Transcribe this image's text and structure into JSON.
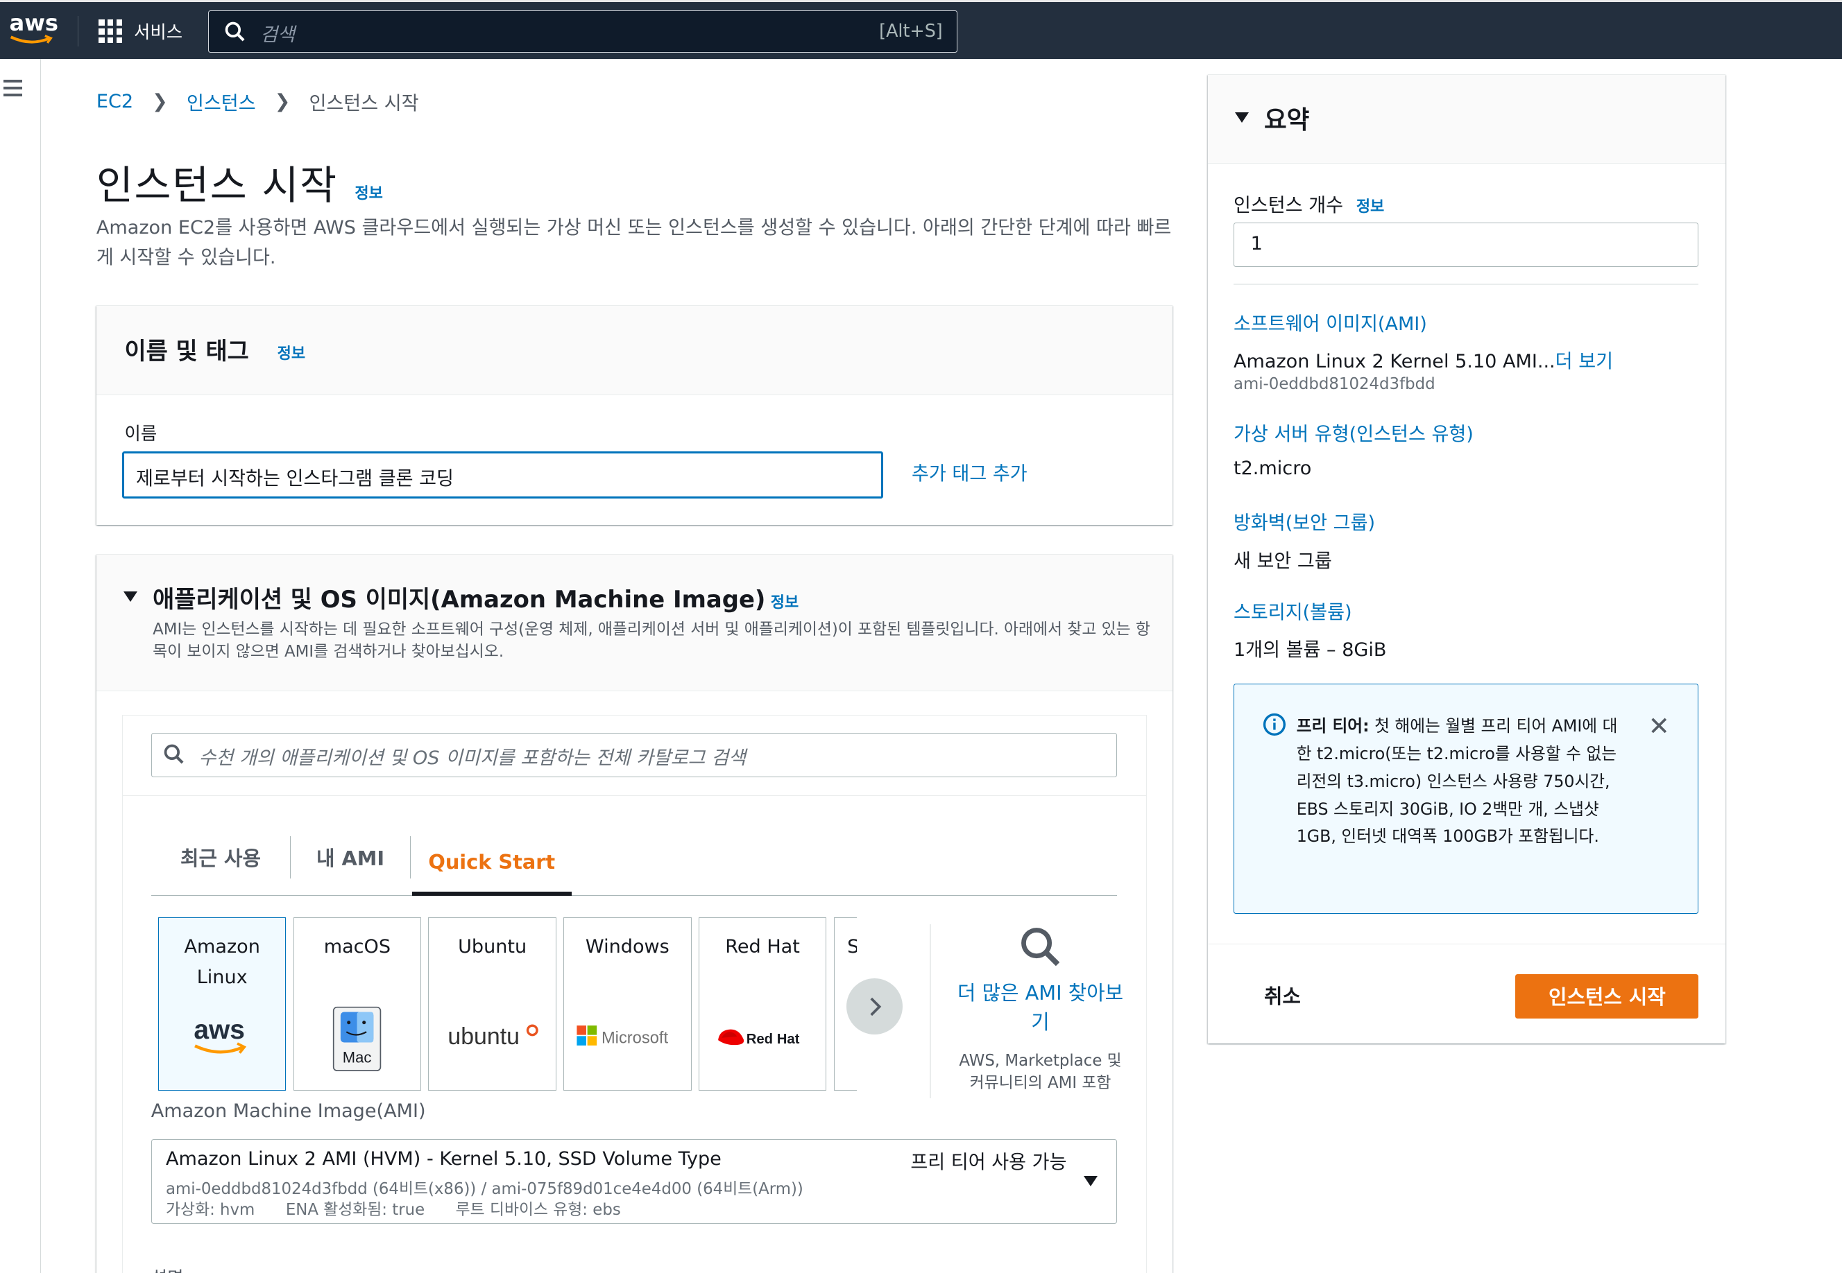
{
  "topnav": {
    "logo_text": "aws",
    "services_label": "서비스",
    "search_placeholder": "검색",
    "search_shortcut": "[Alt+S]"
  },
  "breadcrumb": {
    "items": [
      "EC2",
      "인스턴스",
      "인스턴스 시작"
    ]
  },
  "page": {
    "title": "인스턴스 시작",
    "info": "정보",
    "description": "Amazon EC2를 사용하면 AWS 클라우드에서 실행되는 가상 머신 또는 인스턴스를 생성할 수 있습니다. 아래의 간단한 단계에 따라 빠르게 시작할 수 있습니다."
  },
  "name_tags": {
    "title": "이름 및 태그",
    "info": "정보",
    "name_label": "이름",
    "name_value": "제로부터 시작하는 인스타그램 클론 코딩",
    "add_tag": "추가 태그 추가"
  },
  "ami": {
    "title": "애플리케이션 및 OS 이미지(Amazon Machine Image)",
    "info": "정보",
    "description": "AMI는 인스턴스를 시작하는 데 필요한 소프트웨어 구성(운영 체제, 애플리케이션 서버 및 애플리케이션)이 포함된 템플릿입니다. 아래에서 찾고 있는 항목이 보이지 않으면 AMI를 검색하거나 찾아보십시오.",
    "search_placeholder": "수천 개의 애플리케이션 및 OS 이미지를 포함하는 전체 카탈로그 검색",
    "tabs": [
      "최근 사용",
      "내 AMI",
      "Quick Start"
    ],
    "active_tab": "Quick Start",
    "cards": [
      {
        "label": "Amazon Linux",
        "logo": "aws"
      },
      {
        "label": "macOS",
        "logo": "Mac"
      },
      {
        "label": "Ubuntu",
        "logo": "ubuntu"
      },
      {
        "label": "Windows",
        "logo": "Microsoft"
      },
      {
        "label": "Red Hat",
        "logo": "Red Hat"
      },
      {
        "label": "S",
        "logo": ""
      }
    ],
    "browse_link": "더 많은 AMI 찾아보기",
    "browse_sub": "AWS, Marketplace 및 커뮤니티의 AMI 포함",
    "select_label": "Amazon Machine Image(AMI)",
    "selected": {
      "name": "Amazon Linux 2 AMI (HVM) - Kernel 5.10, SSD Volume Type",
      "ids": "ami-0eddbd81024d3fbdd (64비트(x86)) / ami-075f89d01ce4e4d00 (64비트(Arm))",
      "virt": "가상화: hvm",
      "ena": "ENA 활성화됨: true",
      "root": "루트 디바이스 유형: ebs",
      "free_tier": "프리 티어 사용 가능"
    },
    "desc_label": "설명"
  },
  "summary": {
    "title": "요약",
    "count_label": "인스턴스 개수",
    "info": "정보",
    "count_value": "1",
    "ami_link": "소프트웨어 이미지(AMI)",
    "ami_value": "Amazon Linux 2 Kernel 5.10 AMI...",
    "ami_more": "더 보기",
    "ami_id": "ami-0eddbd81024d3fbdd",
    "type_link": "가상 서버 유형(인스턴스 유형)",
    "type_value": "t2.micro",
    "fw_link": "방화벽(보안 그룹)",
    "fw_value": "새 보안 그룹",
    "storage_link": "스토리지(볼륨)",
    "storage_value": "1개의 볼륨 – 8GiB",
    "free_tier_bold": "프리 티어:",
    "free_tier_text": " 첫 해에는 월별 프리 티어 AMI에 대한 t2.micro(또는 t2.micro를 사용할 수 없는 리전의 t3.micro) 인스턴스 사용량 750시간, EBS 스토리지 30GiB, IO 2백만 개, 스냅샷 1GB, 인터넷 대역폭 100GB가 포함됩니다.",
    "cancel": "취소",
    "launch": "인스턴스 시작"
  },
  "colors": {
    "nav_bg": "#232f3e",
    "link": "#0073bb",
    "accent": "#ec7211"
  }
}
